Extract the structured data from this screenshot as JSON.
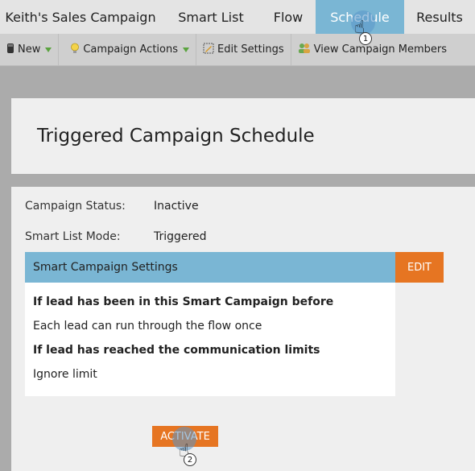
{
  "tabs": [
    {
      "label": "Keith's Sales Campaign"
    },
    {
      "label": "Smart List"
    },
    {
      "label": "Flow"
    },
    {
      "label": "Schedule",
      "active": true
    },
    {
      "label": "Results"
    }
  ],
  "toolbar": {
    "new_label": "New",
    "campaign_actions_label": "Campaign Actions",
    "edit_settings_label": "Edit Settings",
    "view_members_label": "View Campaign Members"
  },
  "page": {
    "title": "Triggered Campaign Schedule"
  },
  "details": {
    "status_label": "Campaign Status:",
    "status_value": "Inactive",
    "mode_label": "Smart List Mode:",
    "mode_value": "Triggered"
  },
  "settings": {
    "header": "Smart Campaign Settings",
    "edit_label": "EDIT",
    "lines": [
      "If lead has been in this Smart Campaign before",
      "Each lead can run through the flow once",
      "If lead has reached the communication limits",
      "Ignore limit"
    ]
  },
  "activate_label": "ACTIVATE",
  "callouts": {
    "step1": "1",
    "step2": "2"
  },
  "colors": {
    "accent_blue": "#7ab6d4",
    "accent_orange": "#e67522"
  },
  "icons": [
    "new-icon",
    "lightbulb-icon",
    "edit-settings-icon",
    "members-icon",
    "hand-cursor-icon"
  ]
}
